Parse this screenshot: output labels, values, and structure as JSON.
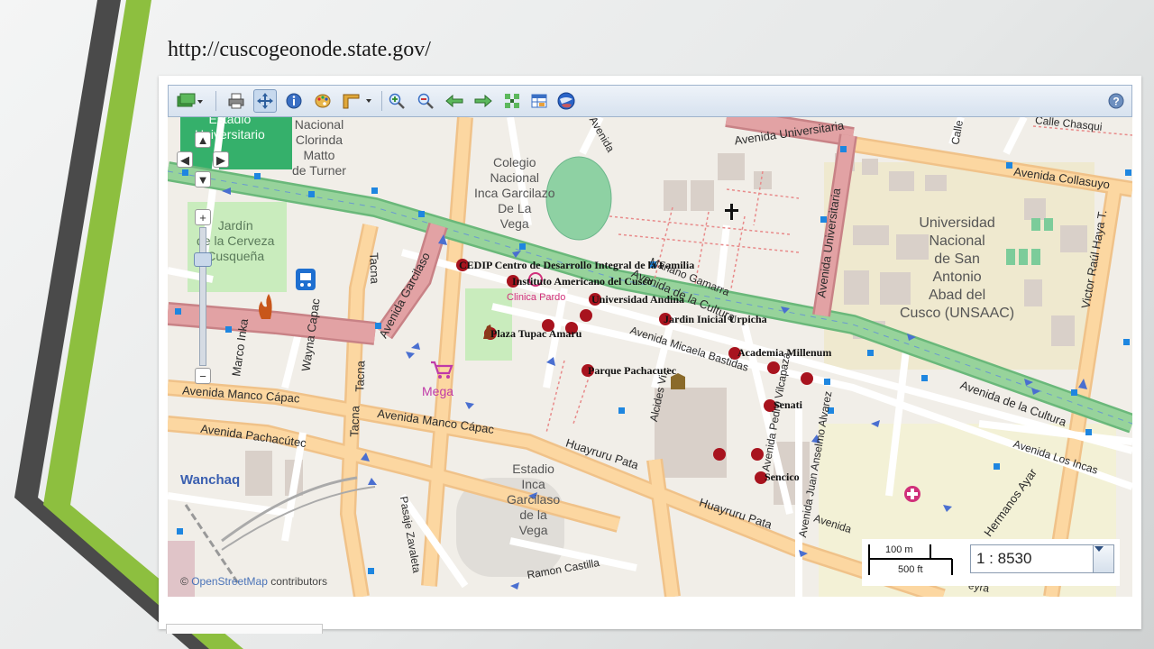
{
  "slide": {
    "caption": "http://cuscogeonode.state.gov/"
  },
  "toolbar": {
    "buttons": [
      {
        "id": "layers-menu",
        "icon": "layers-icon"
      },
      {
        "id": "print",
        "icon": "printer-icon"
      },
      {
        "id": "pan",
        "icon": "pan-icon",
        "active": true
      },
      {
        "id": "info",
        "icon": "info-icon"
      },
      {
        "id": "style",
        "icon": "palette-icon"
      },
      {
        "id": "measure-menu",
        "icon": "ruler-icon"
      },
      {
        "id": "zoom-in",
        "icon": "zoom-in-icon"
      },
      {
        "id": "zoom-out",
        "icon": "zoom-out-icon"
      },
      {
        "id": "back",
        "icon": "arrow-left-icon"
      },
      {
        "id": "forward",
        "icon": "arrow-right-icon"
      },
      {
        "id": "zoom-extent",
        "icon": "zoom-extent-icon"
      },
      {
        "id": "table",
        "icon": "table-icon"
      },
      {
        "id": "google-earth",
        "icon": "globe-icon"
      },
      {
        "id": "help",
        "icon": "help-icon"
      }
    ]
  },
  "map": {
    "streets": {
      "universitaria_top": "Avenida Universitaria",
      "universitaria_vertical": "Avenida Universitaria",
      "collasuyo": "Avenida Collasuyo",
      "victor_raul": "Victor Raúl Haya T.",
      "garcilaso": "Avenida Garcilaso",
      "tacna_top": "Tacna",
      "tacna_bottom": "Tacna",
      "wayna_capac": "Wayna Capac",
      "marco_inka": "Marco Inka",
      "manco_capac_left": "Avenida Manco Cápac",
      "manco_capac_mid": "Avenida Manco Cápac",
      "pachacutec": "Avenida Pachacútec",
      "huayruru_1": "Huayruru Pata",
      "huayruru_2": "Huayruru Pata",
      "micaela": "Avenida Micaela Bastidas",
      "alcides": "Alcides Vi...",
      "pedro_vilcapaza": "Avenida Pedro Vilcapaza",
      "juan_anselmo": "Avenida Juan Anselmo Alvarez",
      "cultura_mid": "Avenida de la Cultura",
      "cultura_right": "Avenida de la Cultura",
      "mariano_gamarra": "Mariano Gamarra",
      "los_incas": "Avenida Los Incas",
      "hermanos_ayar": "Hermanos Ayar",
      "ramon_castilla": "Ramon Castilla",
      "pasaje_zavaleta": "Pasaje Zavaleta",
      "avenida_partial": "Avenida",
      "calle_partial": "Calle",
      "chasqui_partial": "Calle Chasqui",
      "avenida_bottom_partial": "Avenida",
      "eyra_partial": "eyra",
      "universidad_top": "Avenida Universitaria"
    },
    "places": {
      "estadio_univ": "Estadio\nUniversitario",
      "clorinda": "Nacional\nClorinda\nMatto\nde Turner",
      "colegio": "Colegio\nNacional\nInca Garcilazo\nDe La\nVega",
      "jardin": "Jardín\nde la Cerveza\nCusqueña",
      "unsaac": "Universidad\nNacional\nde San\nAntonio\nAbad del\nCusco (UNSAAC)",
      "estadio_inca": "Estadio\nInca\nGarcilaso\nde la\nVega",
      "mega": "Mega",
      "clinica": "Clinica Pardo",
      "wanchaq": "Wanchaq"
    },
    "poi_labels": {
      "cedip": "CEDIP Centro de Desarrollo Integral de la Familia",
      "instituto": "Instituto Americano del Cusco",
      "univ_andina": "Universidad Andina",
      "jardin_inicial": "Jardin Inicial Urpicha",
      "plaza_tupac": "Plaza Tupac Amaru",
      "parque_pachacutec": "Parque Pachacutec",
      "academia": "Academia Millenum",
      "senati": "Senati",
      "sencico": "Sencico"
    },
    "attribution": {
      "prefix": "©",
      "source": "OpenStreetMap",
      "suffix": "contributors"
    },
    "scale": {
      "metric": "100 m",
      "imperial": "500 ft",
      "ratio": "1 : 8530"
    },
    "colors": {
      "land": "#f1eee8",
      "road_major": "#fcd7a1",
      "road_trunk": "#97d39b",
      "road_primary": "#e2a2a4",
      "marker": "#a8131e",
      "park": "#c9ecbd"
    }
  }
}
